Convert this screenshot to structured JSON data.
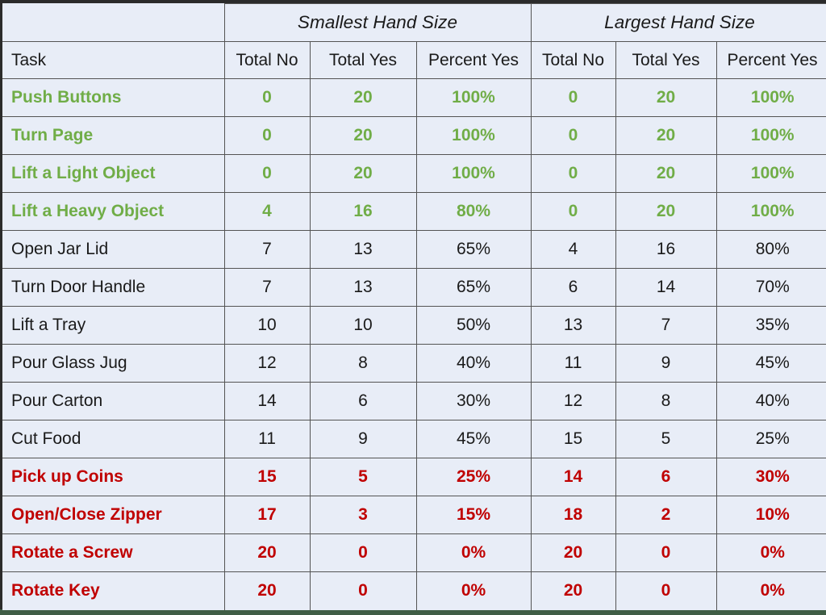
{
  "table": {
    "corner_label": "",
    "group_headers": [
      {
        "label": "Smallest Hand Size",
        "span": 3
      },
      {
        "label": "Largest Hand Size",
        "span": 3
      }
    ],
    "columns": [
      "Task",
      "Total No",
      "Total Yes",
      "Percent Yes",
      "Total No",
      "Total Yes",
      "Percent Yes"
    ],
    "colors": {
      "good": "#70AD47",
      "bad": "#C00000",
      "neutral": "#1A1A1A",
      "cell_background": "#E8EDF7",
      "border": "#545454",
      "page_background": "#3F5D45"
    },
    "rows": [
      {
        "task": "Push Buttons",
        "emphasis": "good",
        "small_no": "0",
        "small_yes": "20",
        "small_pct": "100%",
        "large_no": "0",
        "large_yes": "20",
        "large_pct": "100%"
      },
      {
        "task": "Turn Page",
        "emphasis": "good",
        "small_no": "0",
        "small_yes": "20",
        "small_pct": "100%",
        "large_no": "0",
        "large_yes": "20",
        "large_pct": "100%"
      },
      {
        "task": "Lift a Light Object",
        "emphasis": "good",
        "small_no": "0",
        "small_yes": "20",
        "small_pct": "100%",
        "large_no": "0",
        "large_yes": "20",
        "large_pct": "100%"
      },
      {
        "task": "Lift a Heavy Object",
        "emphasis": "good",
        "small_no": "4",
        "small_yes": "16",
        "small_pct": "80%",
        "large_no": "0",
        "large_yes": "20",
        "large_pct": "100%"
      },
      {
        "task": "Open Jar Lid",
        "emphasis": "neutral",
        "small_no": "7",
        "small_yes": "13",
        "small_pct": "65%",
        "large_no": "4",
        "large_yes": "16",
        "large_pct": "80%"
      },
      {
        "task": "Turn Door Handle",
        "emphasis": "neutral",
        "small_no": "7",
        "small_yes": "13",
        "small_pct": "65%",
        "large_no": "6",
        "large_yes": "14",
        "large_pct": "70%"
      },
      {
        "task": "Lift a Tray",
        "emphasis": "neutral",
        "small_no": "10",
        "small_yes": "10",
        "small_pct": "50%",
        "large_no": "13",
        "large_yes": "7",
        "large_pct": "35%"
      },
      {
        "task": "Pour Glass Jug",
        "emphasis": "neutral",
        "small_no": "12",
        "small_yes": "8",
        "small_pct": "40%",
        "large_no": "11",
        "large_yes": "9",
        "large_pct": "45%"
      },
      {
        "task": "Pour Carton",
        "emphasis": "neutral",
        "small_no": "14",
        "small_yes": "6",
        "small_pct": "30%",
        "large_no": "12",
        "large_yes": "8",
        "large_pct": "40%"
      },
      {
        "task": "Cut Food",
        "emphasis": "neutral",
        "small_no": "11",
        "small_yes": "9",
        "small_pct": "45%",
        "large_no": "15",
        "large_yes": "5",
        "large_pct": "25%"
      },
      {
        "task": "Pick up Coins",
        "emphasis": "bad",
        "small_no": "15",
        "small_yes": "5",
        "small_pct": "25%",
        "large_no": "14",
        "large_yes": "6",
        "large_pct": "30%"
      },
      {
        "task": "Open/Close Zipper",
        "emphasis": "bad",
        "small_no": "17",
        "small_yes": "3",
        "small_pct": "15%",
        "large_no": "18",
        "large_yes": "2",
        "large_pct": "10%"
      },
      {
        "task": "Rotate a Screw",
        "emphasis": "bad",
        "small_no": "20",
        "small_yes": "0",
        "small_pct": "0%",
        "large_no": "20",
        "large_yes": "0",
        "large_pct": "0%"
      },
      {
        "task": "Rotate Key",
        "emphasis": "bad",
        "small_no": "20",
        "small_yes": "0",
        "small_pct": "0%",
        "large_no": "20",
        "large_yes": "0",
        "large_pct": "0%"
      }
    ]
  },
  "chart_data": {
    "type": "table",
    "title": "",
    "categories": [
      "Push Buttons",
      "Turn Page",
      "Lift a Light Object",
      "Lift a Heavy Object",
      "Open Jar Lid",
      "Turn Door Handle",
      "Lift a Tray",
      "Pour Glass Jug",
      "Pour Carton",
      "Cut Food",
      "Pick up Coins",
      "Open/Close Zipper",
      "Rotate a Screw",
      "Rotate Key"
    ],
    "series": [
      {
        "name": "Smallest Hand Size - Total No",
        "values": [
          0,
          0,
          0,
          4,
          7,
          7,
          10,
          12,
          14,
          11,
          15,
          17,
          20,
          20
        ]
      },
      {
        "name": "Smallest Hand Size - Total Yes",
        "values": [
          20,
          20,
          20,
          16,
          13,
          13,
          10,
          8,
          6,
          9,
          5,
          3,
          0,
          0
        ]
      },
      {
        "name": "Smallest Hand Size - Percent Yes",
        "values": [
          100,
          100,
          100,
          80,
          65,
          65,
          50,
          40,
          30,
          45,
          25,
          15,
          0,
          0
        ]
      },
      {
        "name": "Largest Hand Size - Total No",
        "values": [
          0,
          0,
          0,
          0,
          4,
          6,
          13,
          11,
          12,
          15,
          14,
          18,
          20,
          20
        ]
      },
      {
        "name": "Largest Hand Size - Total Yes",
        "values": [
          20,
          20,
          20,
          20,
          16,
          14,
          7,
          9,
          8,
          5,
          6,
          2,
          0,
          0
        ]
      },
      {
        "name": "Largest Hand Size - Percent Yes",
        "values": [
          100,
          100,
          100,
          100,
          80,
          70,
          35,
          45,
          40,
          25,
          30,
          10,
          0,
          0
        ]
      }
    ],
    "xlabel": "Task",
    "ylabel": "",
    "legend_position": "none",
    "grid": true
  }
}
